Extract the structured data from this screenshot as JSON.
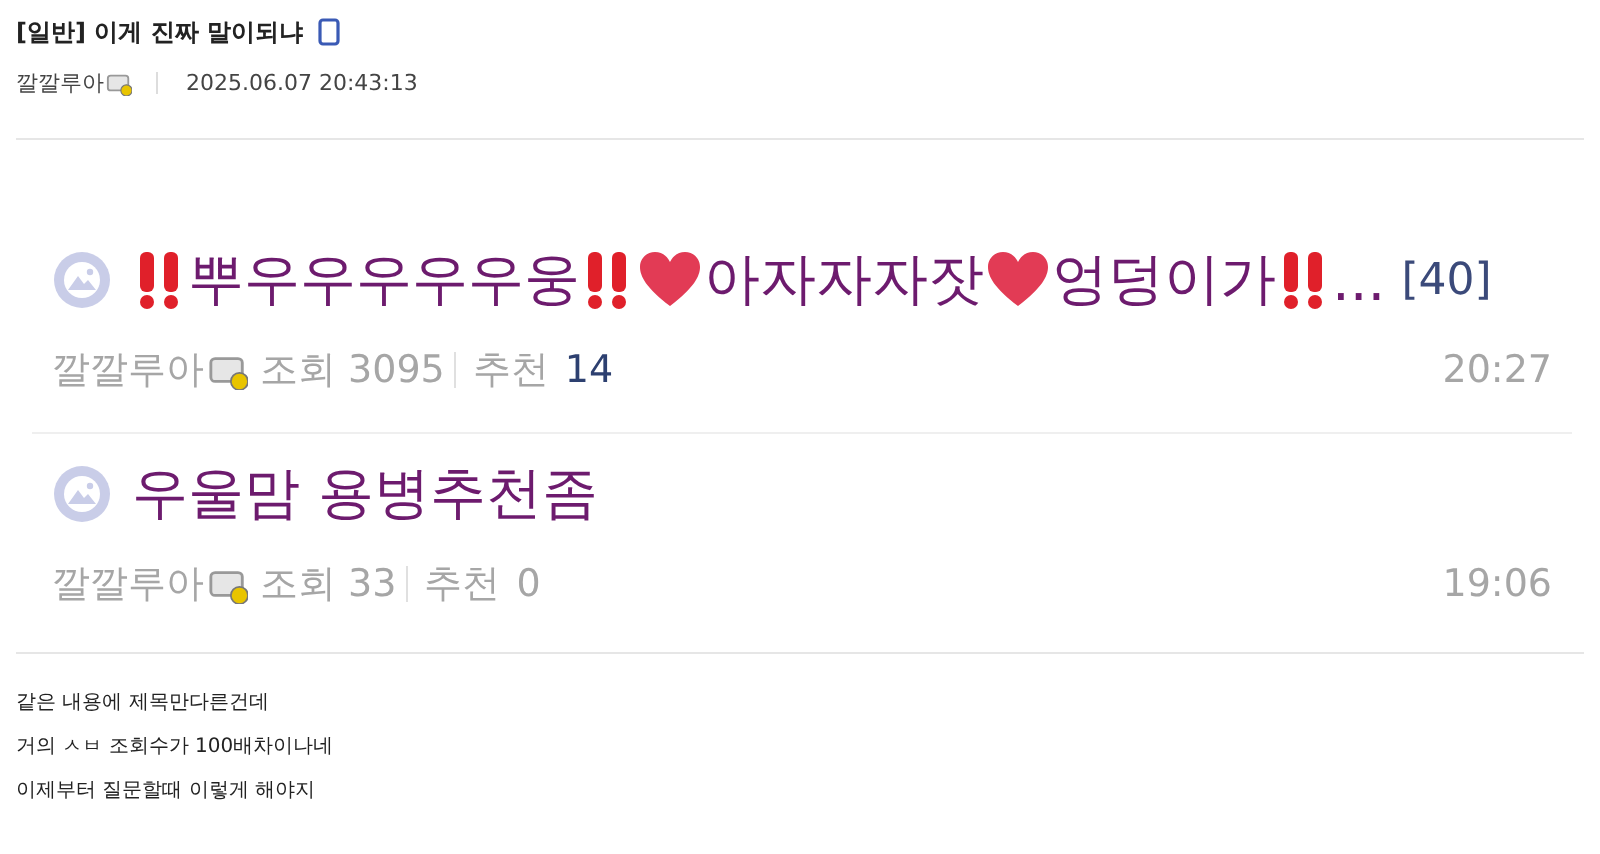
{
  "post": {
    "category": "[일반]",
    "title": "이게 진짜 말이되냐",
    "mobile": true,
    "author": "깔깔루아",
    "date": "2025.06.07 20:43:13"
  },
  "embedded_list": [
    {
      "title_parts": [
        {
          "kind": "exclaim"
        },
        {
          "kind": "text",
          "text": "뿌우우우우우웅"
        },
        {
          "kind": "exclaim"
        },
        {
          "kind": "heart"
        },
        {
          "kind": "text",
          "text": "아자자자잣"
        },
        {
          "kind": "heart"
        },
        {
          "kind": "text",
          "text": "엉덩이가"
        },
        {
          "kind": "exclaim"
        },
        {
          "kind": "text",
          "text": "..."
        }
      ],
      "comments": "[40]",
      "author": "깔깔루아",
      "views_label": "조회",
      "views": "3095",
      "recommend_label": "추천",
      "recommend": "14",
      "recommend_highlight": true,
      "time": "20:27"
    },
    {
      "title_parts": [
        {
          "kind": "text",
          "text": "우울맘 용병추천좀"
        }
      ],
      "author": "깔깔루아",
      "views_label": "조회",
      "views": "33",
      "recommend_label": "추천",
      "recommend": "0",
      "recommend_highlight": false,
      "time": "19:06"
    }
  ],
  "body_lines": [
    "같은 내용에 제목만다른건데",
    "거의 ㅅㅂ 조회수가 100배차이나네",
    "이제부터 질문할때 이렇게 해야지"
  ]
}
